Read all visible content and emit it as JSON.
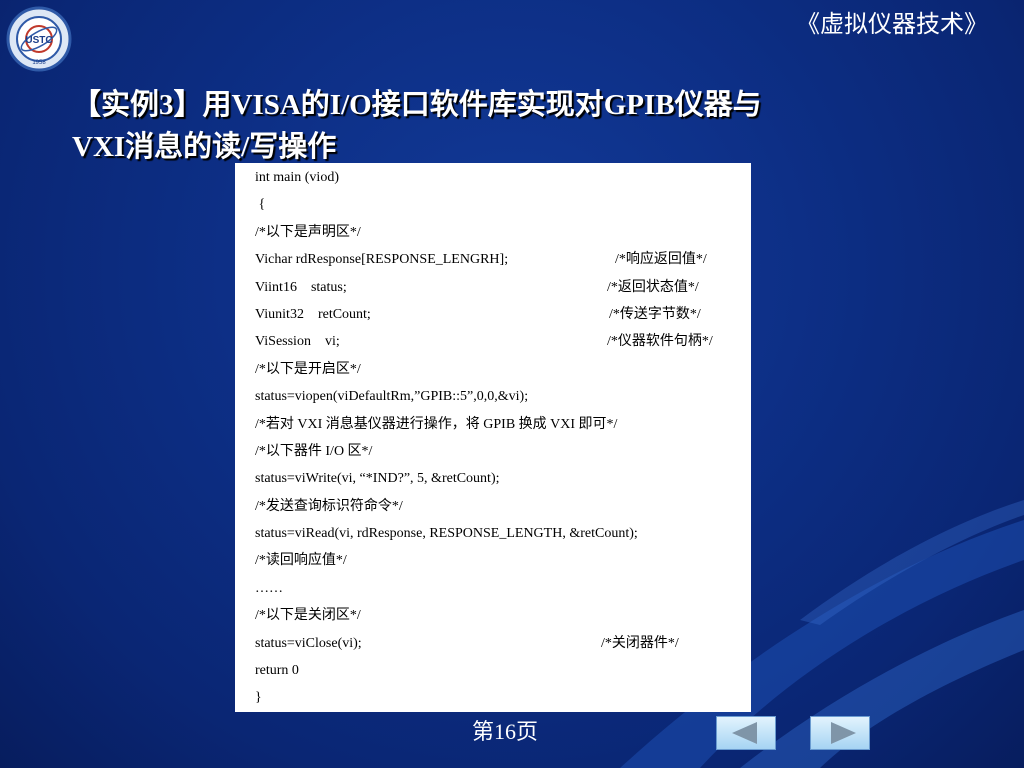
{
  "header": {
    "course_title": "《虚拟仪器技术》"
  },
  "logo": {
    "text": "USTC",
    "year": "1958"
  },
  "slide": {
    "title_line1": "【实例3】用VISA的I/O接口软件库实现对GPIB仪器与",
    "title_line2": "VXI消息的读/写操作"
  },
  "code_lines": [
    {
      "main": "int main (viod)",
      "comment": ""
    },
    {
      "main": " {",
      "comment": ""
    },
    {
      "main": "/*以下是声明区*/",
      "comment": ""
    },
    {
      "main": "Vichar rdResponse[RESPONSE_LENGRH];",
      "comment": "/*响应返回值*/"
    },
    {
      "main": "Viint16    status;",
      "comment": "/*返回状态值*/"
    },
    {
      "main": "Viunit32    retCount;",
      "comment": "/*传送字节数*/"
    },
    {
      "main": "ViSession    vi;",
      "comment": "/*仪器软件句柄*/"
    },
    {
      "main": "/*以下是开启区*/",
      "comment": ""
    },
    {
      "main": "status=viopen(viDefaultRm,”GPIB::5”,0,0,&vi);",
      "comment": ""
    },
    {
      "main": "/*若对 VXI 消息基仪器进行操作，将 GPIB 换成 VXI 即可*/",
      "comment": ""
    },
    {
      "main": "/*以下器件 I/O 区*/",
      "comment": ""
    },
    {
      "main": "status=viWrite(vi, “*IND?”, 5, &retCount);",
      "comment": ""
    },
    {
      "main": "/*发送查询标识符命令*/",
      "comment": ""
    },
    {
      "main": "status=viRead(vi, rdResponse, RESPONSE_LENGTH, &retCount);",
      "comment": ""
    },
    {
      "main": "/*读回响应值*/",
      "comment": ""
    },
    {
      "main": "……",
      "comment": ""
    },
    {
      "main": "/*以下是关闭区*/",
      "comment": ""
    },
    {
      "main": "status=viClose(vi);",
      "comment": "/*关闭器件*/"
    },
    {
      "main": "return 0",
      "comment": ""
    },
    {
      "main": "}",
      "comment": ""
    }
  ],
  "footer": {
    "page_label": "第16页"
  },
  "nav": {
    "prev_icon": "arrow-left-icon",
    "next_icon": "arrow-right-icon",
    "arrow_color": "#7f95a8"
  },
  "colors": {
    "background": "#0d2f86",
    "title_text": "#ffffff",
    "panel": "#ffffff"
  }
}
